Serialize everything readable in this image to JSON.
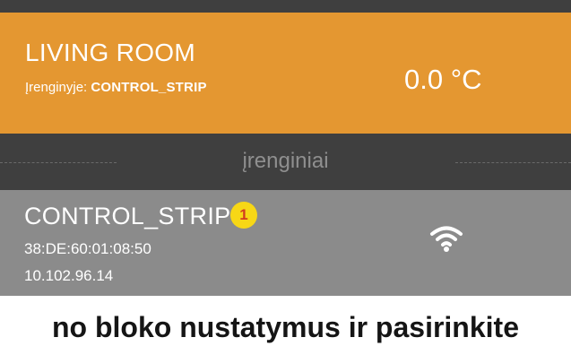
{
  "room": {
    "title": "LIVING ROOM",
    "device_prefix": "Įrenginyje: ",
    "device_name": "CONTROL_STRIP",
    "temperature": "0.0 °C"
  },
  "section": {
    "title": "įrenginiai"
  },
  "device": {
    "name": "CONTROL_STRIP",
    "mac": "38:DE:60:01:08:50",
    "ip": "10.102.96.14",
    "marker": "1",
    "status_icon": "wifi-icon"
  },
  "bottom_text": "no bloko nustatymus ir pasirinkite",
  "colors": {
    "room_card": "#e49731",
    "dark_header": "#3f3f3f",
    "device_card": "#8b8b8b",
    "marker": "#f7d716",
    "marker_text": "#d23c20"
  }
}
